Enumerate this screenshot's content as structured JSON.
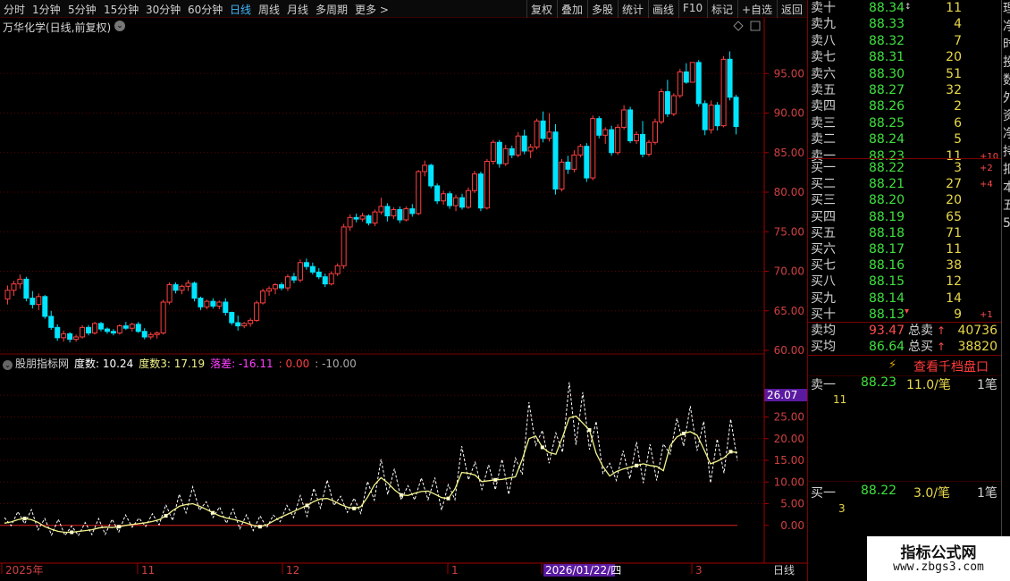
{
  "toolbar": {
    "timeframes": [
      "分时",
      "1分钟",
      "5分钟",
      "15分钟",
      "30分钟",
      "60分钟",
      "日线",
      "周线",
      "月线",
      "多周期",
      "更多 >"
    ],
    "active_timeframe": "日线",
    "buttons": [
      "复权",
      "叠加",
      "多股",
      "统计",
      "画线",
      "F10",
      "标记",
      "+自选",
      "返回"
    ]
  },
  "chart_header": {
    "title": "万华化学(日线,前复权)"
  },
  "indicator": {
    "name": "股朋指标网",
    "label1": "度数: 10.24",
    "label2": "度数3: 17.19",
    "label3": "落差: -16.11",
    "label4": ": 0.00",
    "label5": ": -10.00",
    "tag_value": "26.07"
  },
  "x_axis": {
    "labels": [
      "2025年",
      "11",
      "12",
      "1",
      "2026/01/22/四",
      "3"
    ],
    "period": "日线"
  },
  "order_book": {
    "asks": [
      {
        "label": "卖十",
        "price": "88.34",
        "vol": "11",
        "chg": ""
      },
      {
        "label": "卖九",
        "price": "88.33",
        "vol": "4",
        "chg": ""
      },
      {
        "label": "卖八",
        "price": "88.32",
        "vol": "7",
        "chg": ""
      },
      {
        "label": "卖七",
        "price": "88.31",
        "vol": "20",
        "chg": ""
      },
      {
        "label": "卖六",
        "price": "88.30",
        "vol": "51",
        "chg": ""
      },
      {
        "label": "卖五",
        "price": "88.27",
        "vol": "32",
        "chg": ""
      },
      {
        "label": "卖四",
        "price": "88.26",
        "vol": "2",
        "chg": ""
      },
      {
        "label": "卖三",
        "price": "88.25",
        "vol": "6",
        "chg": ""
      },
      {
        "label": "卖二",
        "price": "88.24",
        "vol": "5",
        "chg": ""
      },
      {
        "label": "卖一",
        "price": "88.23",
        "vol": "11",
        "chg": "+10"
      }
    ],
    "bids": [
      {
        "label": "买一",
        "price": "88.22",
        "vol": "3",
        "chg": "+2"
      },
      {
        "label": "买二",
        "price": "88.21",
        "vol": "27",
        "chg": "+4"
      },
      {
        "label": "买三",
        "price": "88.20",
        "vol": "20",
        "chg": ""
      },
      {
        "label": "买四",
        "price": "88.19",
        "vol": "65",
        "chg": ""
      },
      {
        "label": "买五",
        "price": "88.18",
        "vol": "71",
        "chg": ""
      },
      {
        "label": "买六",
        "price": "88.17",
        "vol": "11",
        "chg": ""
      },
      {
        "label": "买七",
        "price": "88.16",
        "vol": "38",
        "chg": ""
      },
      {
        "label": "买八",
        "price": "88.15",
        "vol": "12",
        "chg": ""
      },
      {
        "label": "买九",
        "price": "88.14",
        "vol": "14",
        "chg": ""
      },
      {
        "label": "买十",
        "price": "88.13",
        "vol": "9",
        "chg": "+1"
      }
    ],
    "avg_ask_label": "卖均",
    "avg_ask": "93.47",
    "total_ask_label": "总卖",
    "total_ask": "40736",
    "avg_bid_label": "买均",
    "avg_bid": "86.64",
    "total_bid_label": "总买",
    "total_bid": "38820"
  },
  "trade_detail": {
    "button": "查看千档盘口",
    "ask1_label": "卖一",
    "ask1_price": "88.23",
    "ask1_size": "11.0/笔",
    "ask1_count": "1笔",
    "ask1_sub": "11",
    "bid1_label": "买一",
    "bid1_price": "88.22",
    "bid1_size": "3.0/笔",
    "bid1_count": "1笔",
    "bid1_sub": "3"
  },
  "side_strip": [
    "理",
    "净",
    "时",
    "投",
    "数",
    "外",
    "资",
    "净",
    "持",
    "扣",
    "本",
    "五",
    "5"
  ],
  "watermark": {
    "line1": "指标公式网",
    "line2": "www.zbgs3.com"
  },
  "colors": {
    "up": "#ff4040",
    "down": "#00e5ff",
    "yellow": "#f2f28a",
    "white": "#ffffff",
    "grid": "#5a0000"
  },
  "chart_data": [
    {
      "type": "candlestick",
      "title": "万华化学(日线,前复权)",
      "ylim": [
        60,
        100
      ],
      "y_ticks": [
        60,
        65,
        70,
        75,
        80,
        85,
        90,
        95
      ],
      "x_tick_labels": [
        "2025年",
        "11",
        "12",
        "1",
        "2026/01/22/四",
        "3"
      ],
      "candles": [
        [
          66.5,
          68.2,
          65.8,
          67.6
        ],
        [
          67.6,
          68.8,
          66.9,
          68.4
        ],
        [
          68.4,
          69.6,
          67.8,
          69.0
        ],
        [
          69.0,
          69.3,
          66.2,
          66.6
        ],
        [
          66.6,
          67.5,
          65.3,
          65.8
        ],
        [
          65.8,
          67.2,
          65.1,
          66.8
        ],
        [
          66.8,
          67.0,
          64.0,
          64.3
        ],
        [
          64.3,
          65.0,
          62.6,
          62.9
        ],
        [
          62.9,
          63.3,
          61.2,
          61.6
        ],
        [
          61.6,
          62.5,
          61.1,
          62.1
        ],
        [
          62.1,
          62.3,
          61.0,
          61.4
        ],
        [
          61.4,
          62.0,
          61.1,
          61.7
        ],
        [
          61.7,
          63.2,
          61.5,
          62.9
        ],
        [
          62.9,
          63.2,
          61.9,
          62.2
        ],
        [
          62.2,
          63.6,
          62.0,
          63.4
        ],
        [
          63.4,
          63.6,
          62.4,
          62.7
        ],
        [
          62.7,
          62.9,
          62.1,
          62.4
        ],
        [
          62.4,
          62.7,
          61.9,
          62.2
        ],
        [
          62.2,
          63.3,
          62.0,
          63.1
        ],
        [
          63.1,
          63.6,
          62.6,
          62.8
        ],
        [
          62.8,
          63.5,
          62.4,
          63.3
        ],
        [
          63.3,
          63.6,
          62.2,
          62.4
        ],
        [
          62.4,
          62.8,
          61.4,
          61.7
        ],
        [
          61.7,
          62.3,
          61.4,
          62.0
        ],
        [
          62.0,
          62.4,
          61.5,
          62.2
        ],
        [
          62.2,
          66.4,
          62.0,
          66.1
        ],
        [
          66.1,
          68.6,
          65.8,
          68.3
        ],
        [
          68.3,
          68.6,
          67.2,
          67.6
        ],
        [
          67.6,
          68.3,
          67.1,
          68.1
        ],
        [
          68.1,
          68.9,
          67.5,
          68.5
        ],
        [
          68.5,
          68.7,
          66.2,
          66.6
        ],
        [
          66.6,
          66.8,
          65.1,
          65.5
        ],
        [
          65.5,
          66.4,
          65.2,
          66.2
        ],
        [
          66.2,
          66.6,
          65.3,
          65.6
        ],
        [
          65.6,
          66.3,
          65.2,
          66.1
        ],
        [
          66.1,
          66.6,
          64.4,
          64.8
        ],
        [
          64.8,
          64.9,
          63.2,
          63.5
        ],
        [
          63.5,
          64.4,
          62.5,
          63.1
        ],
        [
          63.1,
          63.6,
          62.8,
          63.4
        ],
        [
          63.4,
          64.1,
          63.0,
          63.8
        ],
        [
          63.8,
          66.3,
          63.6,
          66.0
        ],
        [
          66.0,
          67.8,
          65.8,
          67.5
        ],
        [
          67.5,
          68.1,
          66.9,
          67.8
        ],
        [
          67.8,
          68.5,
          67.1,
          68.3
        ],
        [
          68.3,
          68.6,
          67.6,
          67.9
        ],
        [
          67.9,
          69.6,
          67.5,
          69.3
        ],
        [
          69.3,
          69.8,
          68.5,
          68.9
        ],
        [
          68.9,
          71.5,
          68.6,
          71.1
        ],
        [
          71.1,
          71.6,
          70.2,
          70.6
        ],
        [
          70.6,
          71.1,
          69.6,
          69.9
        ],
        [
          69.9,
          70.4,
          69.0,
          69.3
        ],
        [
          69.3,
          69.7,
          68.0,
          68.4
        ],
        [
          68.4,
          70.0,
          68.2,
          69.7
        ],
        [
          69.7,
          71.0,
          69.4,
          70.7
        ],
        [
          70.7,
          76.0,
          70.3,
          75.6
        ],
        [
          75.6,
          77.2,
          75.1,
          76.8
        ],
        [
          76.8,
          77.3,
          76.2,
          76.6
        ],
        [
          76.6,
          77.4,
          76.3,
          77.0
        ],
        [
          77.0,
          77.2,
          75.8,
          76.1
        ],
        [
          76.1,
          77.8,
          75.7,
          77.5
        ],
        [
          77.5,
          79.3,
          77.2,
          78.2
        ],
        [
          78.2,
          78.6,
          76.3,
          77.0
        ],
        [
          77.0,
          78.1,
          76.6,
          77.8
        ],
        [
          77.8,
          78.2,
          76.1,
          76.5
        ],
        [
          76.5,
          78.2,
          76.3,
          77.9
        ],
        [
          77.9,
          78.5,
          76.9,
          77.3
        ],
        [
          77.3,
          82.8,
          77.1,
          82.6
        ],
        [
          82.6,
          84.0,
          82.0,
          83.4
        ],
        [
          83.4,
          83.6,
          80.5,
          80.8
        ],
        [
          80.8,
          81.1,
          78.5,
          78.9
        ],
        [
          78.9,
          80.2,
          78.4,
          79.8
        ],
        [
          79.8,
          80.1,
          77.9,
          78.3
        ],
        [
          78.3,
          79.7,
          77.6,
          79.3
        ],
        [
          79.3,
          79.8,
          77.8,
          78.1
        ],
        [
          78.1,
          80.6,
          77.9,
          80.2
        ],
        [
          80.2,
          82.7,
          79.9,
          82.3
        ],
        [
          82.3,
          82.6,
          77.6,
          78.0
        ],
        [
          78.0,
          84.2,
          77.8,
          83.9
        ],
        [
          83.9,
          86.6,
          83.5,
          86.3
        ],
        [
          86.3,
          86.6,
          83.1,
          83.6
        ],
        [
          83.6,
          86.0,
          83.3,
          85.5
        ],
        [
          85.5,
          85.9,
          84.3,
          84.7
        ],
        [
          84.7,
          87.6,
          84.4,
          87.1
        ],
        [
          87.1,
          87.9,
          84.8,
          85.2
        ],
        [
          85.2,
          86.1,
          84.3,
          85.7
        ],
        [
          85.7,
          89.3,
          85.4,
          89.0
        ],
        [
          89.0,
          90.2,
          86.3,
          86.8
        ],
        [
          86.8,
          90.0,
          86.4,
          87.6
        ],
        [
          87.6,
          88.6,
          79.7,
          80.4
        ],
        [
          80.4,
          84.2,
          80.1,
          83.8
        ],
        [
          83.8,
          84.6,
          82.3,
          82.9
        ],
        [
          82.9,
          85.3,
          82.5,
          84.7
        ],
        [
          84.7,
          86.1,
          84.4,
          85.8
        ],
        [
          85.8,
          86.2,
          81.3,
          81.8
        ],
        [
          81.8,
          89.7,
          81.5,
          89.3
        ],
        [
          89.3,
          89.6,
          86.8,
          87.2
        ],
        [
          87.2,
          88.2,
          86.1,
          87.9
        ],
        [
          87.9,
          88.4,
          84.6,
          85.0
        ],
        [
          85.0,
          88.6,
          84.7,
          88.2
        ],
        [
          88.2,
          91.0,
          87.9,
          90.4
        ],
        [
          90.4,
          90.8,
          86.2,
          86.5
        ],
        [
          86.5,
          87.7,
          86.1,
          87.3
        ],
        [
          87.3,
          89.0,
          84.4,
          84.8
        ],
        [
          84.8,
          86.6,
          84.5,
          86.3
        ],
        [
          86.3,
          89.3,
          86.0,
          88.9
        ],
        [
          88.9,
          93.1,
          88.6,
          92.7
        ],
        [
          92.7,
          94.2,
          89.5,
          89.9
        ],
        [
          89.9,
          92.5,
          89.6,
          92.2
        ],
        [
          92.2,
          95.6,
          91.9,
          95.2
        ],
        [
          95.2,
          96.3,
          93.7,
          93.9
        ],
        [
          93.9,
          94.8,
          95.4,
          96.4
        ],
        [
          96.4,
          96.7,
          90.8,
          91.2
        ],
        [
          91.2,
          91.6,
          87.2,
          87.9
        ],
        [
          87.9,
          91.6,
          87.4,
          91.0
        ],
        [
          91.0,
          91.4,
          87.8,
          88.4
        ],
        [
          88.4,
          97.2,
          88.2,
          96.8
        ],
        [
          96.8,
          97.8,
          91.6,
          92.0
        ],
        [
          92.0,
          92.3,
          87.3,
          88.3
        ]
      ]
    },
    {
      "type": "line",
      "title": "股朋指标网",
      "ylim": [
        -5,
        35
      ],
      "y_ticks": [
        0,
        5,
        10,
        15,
        20,
        25,
        30
      ],
      "series": [
        {
          "name": "度数3",
          "color": "#f2f28a",
          "values": [
            0.5,
            0.8,
            1.3,
            1.6,
            1.3,
            0.7,
            -0.3,
            -0.9,
            -1.4,
            -1.6,
            -1.6,
            -1.4,
            -1.2,
            -1.0,
            -0.6,
            -0.4,
            -0.5,
            -0.3,
            0.0,
            0.2,
            0.4,
            0.6,
            0.9,
            1.3,
            2.2,
            3.4,
            4.4,
            4.8,
            5.0,
            4.4,
            3.7,
            2.9,
            2.2,
            1.7,
            1.4,
            1.0,
            0.5,
            0.0,
            -0.3,
            0.1,
            1.0,
            1.8,
            2.5,
            3.2,
            3.9,
            4.6,
            5.5,
            6.1,
            6.2,
            5.6,
            4.8,
            4.2,
            3.9,
            4.3,
            6.5,
            9.3,
            11.0,
            9.8,
            8.2,
            7.0,
            6.9,
            7.4,
            7.8,
            7.9,
            7.2,
            6.4,
            6.2,
            8.4,
            12.2,
            12.0,
            11.6,
            10.1,
            10.3,
            10.5,
            10.6,
            10.9,
            11.2,
            15.2,
            20.0,
            20.6,
            18.0,
            16.8,
            16.4,
            20.4,
            24.8,
            25.2,
            23.6,
            22.0,
            16.6,
            13.6,
            11.4,
            12.4,
            13.0,
            13.4,
            13.8,
            14.2,
            13.8,
            13.6,
            12.6,
            18.4,
            20.4,
            21.2,
            21.6,
            20.8,
            17.6,
            14.2,
            14.8,
            15.6,
            17.0,
            16.8
          ]
        }
      ]
    }
  ]
}
